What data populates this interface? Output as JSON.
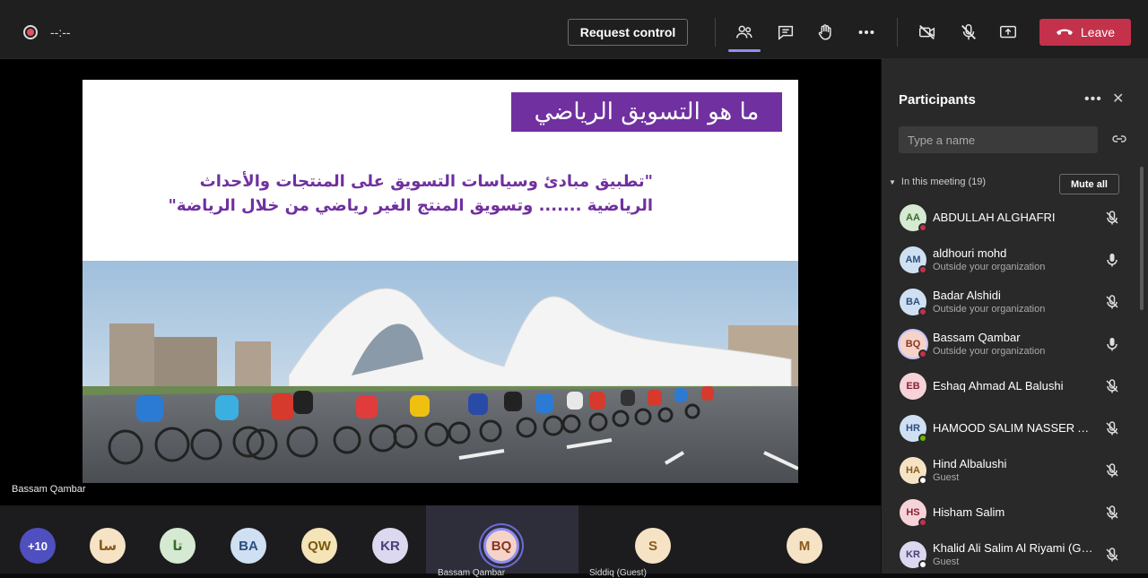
{
  "topbar": {
    "timer": "--:--",
    "request_control": "Request control",
    "leave": "Leave"
  },
  "slide": {
    "title": "ما هو التسويق الرياضي",
    "body_line1": "\"تطبيق مبادئ وسياسات التسويق على المنتجات والأحداث",
    "body_line2": "الرياضية ....... وتسويق المنتج الغير رياضي من خلال الرياضة\""
  },
  "presenter_name": "Bassam Qambar",
  "strip": {
    "more": "+10",
    "avatars": [
      {
        "initials": "سا",
        "bg": "#f6e3c6",
        "fg": "#8a5a1a"
      },
      {
        "initials": "تا",
        "bg": "#d6e9d2",
        "fg": "#3a6b2a"
      },
      {
        "initials": "BA",
        "bg": "#cfe0f3",
        "fg": "#2c4f7c"
      },
      {
        "initials": "QW",
        "bg": "#f4e4b8",
        "fg": "#7a5a10"
      },
      {
        "initials": "KR",
        "bg": "#dcd8ef",
        "fg": "#4a3f7a"
      },
      {
        "initials": "BQ",
        "bg": "#f6d3c9",
        "fg": "#8a3522"
      },
      {
        "initials": "S",
        "bg": "#f6e3c6",
        "fg": "#8a5a1a"
      },
      {
        "initials": "M",
        "bg": "#f6e3c6",
        "fg": "#8a5a1a"
      }
    ],
    "labels": [
      "Bassam Qambar",
      "Siddiq (Guest)"
    ]
  },
  "panel": {
    "title": "Participants",
    "search_placeholder": "Type a name",
    "in_meeting": "In this meeting (19)",
    "mute_all": "Mute all",
    "participants": [
      {
        "initials": "AA",
        "name": "ABDULLAH ALGHAFRI",
        "sub": "",
        "bg": "#d6e9d2",
        "fg": "#3a6b2a",
        "status": "#c4314b",
        "mic": "muted"
      },
      {
        "initials": "AM",
        "name": "aldhouri mohd",
        "sub": "Outside your organization",
        "bg": "#cfe0f3",
        "fg": "#2c4f7c",
        "status": "#c4314b",
        "mic": "on"
      },
      {
        "initials": "BA",
        "name": "Badar Alshidi",
        "sub": "Outside your organization",
        "bg": "#cfe0f3",
        "fg": "#2c4f7c",
        "status": "#c4314b",
        "mic": "muted"
      },
      {
        "initials": "BQ",
        "name": "Bassam Qambar",
        "sub": "Outside your organization",
        "bg": "#f6d3c9",
        "fg": "#8a3522",
        "status": "#c4314b",
        "mic": "on",
        "selected": true
      },
      {
        "initials": "EB",
        "name": "Eshaq Ahmad AL Balushi",
        "sub": "",
        "bg": "#f6d3d8",
        "fg": "#8a2235",
        "status": "",
        "mic": "muted"
      },
      {
        "initials": "HR",
        "name": "HAMOOD SALIM NASSER AL ...",
        "sub": "",
        "bg": "#cfe0f3",
        "fg": "#2c4f7c",
        "status": "#6bb700",
        "mic": "muted"
      },
      {
        "initials": "HA",
        "name": "Hind Albalushi",
        "sub": "Guest",
        "bg": "#f6e3c6",
        "fg": "#8a5a1a",
        "status": "#ffffff",
        "mic": "muted"
      },
      {
        "initials": "HS",
        "name": "Hisham Salim",
        "sub": "",
        "bg": "#f6d3d8",
        "fg": "#8a2235",
        "status": "#c4314b",
        "mic": "muted"
      },
      {
        "initials": "KR",
        "name": "Khalid Ali Salim Al Riyami (Gu...",
        "sub": "Guest",
        "bg": "#dcd8ef",
        "fg": "#4a3f7a",
        "status": "#ffffff",
        "mic": "muted"
      }
    ]
  }
}
